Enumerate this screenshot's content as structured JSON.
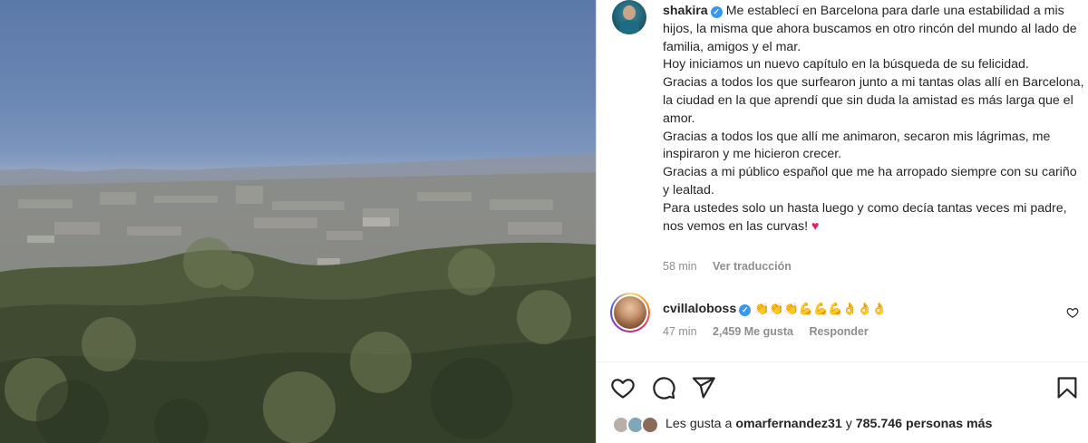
{
  "post": {
    "username": "shakira",
    "caption_first": "Me establecí en Barcelona para darle una estabilidad a mis hijos, la misma que ahora buscamos en otro rincón del mundo al lado de familia, amigos y el mar.",
    "caption_lines": [
      "Hoy iniciamos un nuevo capítulo en la búsqueda de su felicidad.",
      "Gracias a todos los que surfearon junto a mi tantas olas allí en Barcelona, la ciudad en la que aprendí que sin duda la amistad es más larga que el amor.",
      "Gracias a todos los que allí me animaron, secaron mis lágrimas, me inspiraron y me hicieron crecer.",
      "Gracias a mi público español que me ha arropado siempre con su cariño y lealtad.",
      "Para ustedes solo un hasta luego y como decía tantas veces mi padre, nos vemos en las curvas!"
    ],
    "caption_emoji": "♥",
    "time_ago": "58 min",
    "translate_label": "Ver traducción"
  },
  "comment": {
    "username": "cvillaloboss",
    "text": "👏👏👏💪💪💪👌👌👌",
    "time_ago": "47 min",
    "likes": "2,459 Me gusta",
    "reply_label": "Responder"
  },
  "likes": {
    "prefix": "Les gusta a ",
    "user": "omarfernandez31",
    "middle": " y ",
    "count": "785.746 personas más"
  },
  "icons": {
    "like": "heart-icon",
    "comment": "comment-icon",
    "share": "share-icon",
    "save": "bookmark-icon",
    "verified": "verified-badge-icon"
  },
  "colors": {
    "verified": "#3897f0",
    "text": "#262626",
    "secondary": "#8e8e8e",
    "heart": "#e0245e"
  }
}
